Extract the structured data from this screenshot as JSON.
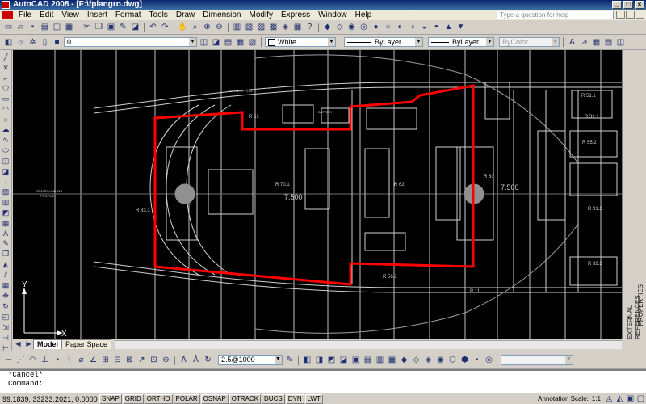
{
  "window": {
    "title": "AutoCAD 2008 - [F:\\fplangro.dwg]",
    "controls": [
      "_",
      "□",
      "×"
    ]
  },
  "menu": {
    "items": [
      "File",
      "Edit",
      "View",
      "Insert",
      "Format",
      "Tools",
      "Draw",
      "Dimension",
      "Modify",
      "Express",
      "Window",
      "Help"
    ],
    "search_placeholder": "Type a question for help"
  },
  "layer_toolbar": {
    "layer": "0"
  },
  "properties_toolbar": {
    "color": "White",
    "linetype": "ByLayer",
    "lineweight": "ByLayer",
    "plotstyle": "ByColor"
  },
  "drawing": {
    "room_labels": [
      "R 70.1",
      "R 62",
      "R 83",
      "R 83.1",
      "R 51.1",
      "R 32.1",
      "R 55.2",
      "R 91.2",
      "R 32.2",
      "R 56.1",
      "R 51",
      "R 11"
    ],
    "dimension_labels": [
      "7.500",
      "7.500"
    ],
    "small_labels": [
      "BATTERY FLUE",
      "BATTERY",
      "CENTERLINE 128",
      "PROFILE"
    ],
    "ucs": {
      "x_label": "X",
      "y_label": "Y"
    }
  },
  "palette_tabs": [
    "PROPERTIES",
    "EXTERNAL REFERENCES"
  ],
  "layout_tabs": [
    {
      "label": "Model",
      "active": true
    },
    {
      "label": "Paper Space",
      "active": false
    }
  ],
  "dim_toolbar": {
    "scale": "2.5@1000"
  },
  "command": {
    "history": "*Cancel*",
    "prompt": "Command:"
  },
  "status": {
    "coordinates": "99.1839,  33233.2021, 0.0000",
    "toggles": [
      "SNAP",
      "GRID",
      "ORTHO",
      "POLAR",
      "OSNAP",
      "OTRACK",
      "DUCS",
      "DYN",
      "LWT"
    ],
    "annotation_scale_label": "Annotation Scale:",
    "annotation_scale": "1:1"
  },
  "colors": {
    "canvas": "#000000",
    "outline": "#ff0000",
    "lines": "#bfbfbf"
  }
}
